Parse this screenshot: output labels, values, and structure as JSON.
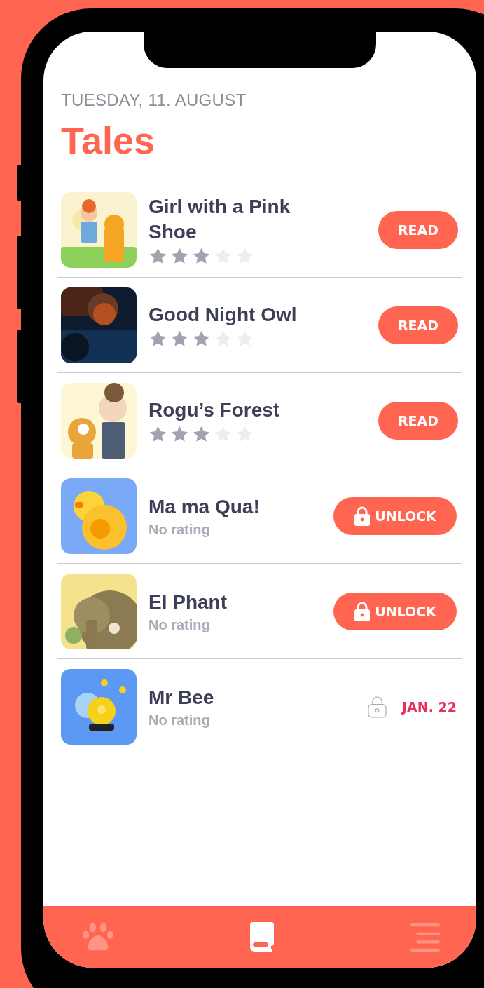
{
  "date": "TUESDAY, 11. AUGUST",
  "title": "Tales",
  "tales": [
    {
      "title": "Girl with a Pink Shoe",
      "stars": 3,
      "action": {
        "kind": "read",
        "label": "READ"
      }
    },
    {
      "title": "Good Night Owl",
      "stars": 3,
      "action": {
        "kind": "read",
        "label": "READ"
      }
    },
    {
      "title": "Rogu’s Forest",
      "stars": 3,
      "action": {
        "kind": "read",
        "label": "READ"
      }
    },
    {
      "title": "Ma ma Qua!",
      "rating": "No rating",
      "action": {
        "kind": "unlock",
        "label": "UNLOCK"
      }
    },
    {
      "title": "El Phant",
      "rating": "No rating",
      "action": {
        "kind": "unlock",
        "label": "UNLOCK"
      }
    },
    {
      "title": "Mr Bee",
      "rating": "No rating",
      "action": {
        "kind": "scheduled",
        "label": "JAN. 22"
      }
    }
  ],
  "tab_bar": [
    {
      "selected": false
    },
    {
      "selected": true
    },
    {
      "selected": false
    }
  ]
}
